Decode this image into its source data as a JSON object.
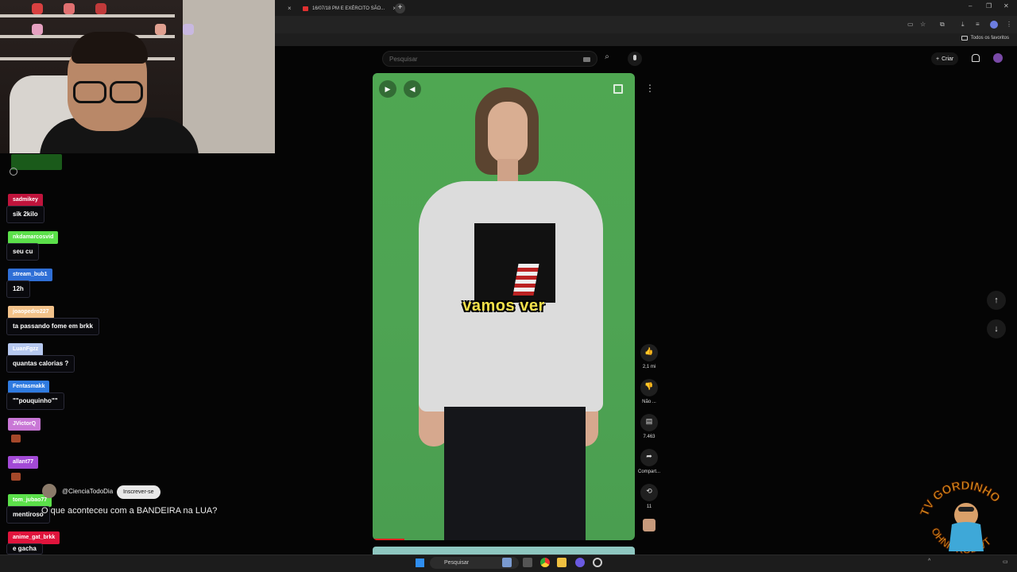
{
  "browser": {
    "tabs": [
      {
        "title": ""
      },
      {
        "title": "16/07/18 PM E EXÉRCITO SÃO..."
      }
    ],
    "bookmarks_label": "Todos os favoritos"
  },
  "youtube": {
    "search_placeholder": "Pesquisar",
    "create_label": "Criar",
    "caption": "vamos ver",
    "actions": {
      "likes": "2,1 mi",
      "dislike_label": "Não ...",
      "comments": "7.463",
      "share_label": "Compart...",
      "remix_count": "11"
    },
    "channel_name": "@CienciaTodoDia",
    "subscribe_label": "Inscrever-se",
    "short_title": "O que aconteceu com a BANDEIRA na LUA?"
  },
  "chat": {
    "messages": [
      {
        "user": "sadmikey",
        "text": "sik 2kilo",
        "color": "#c0143c"
      },
      {
        "user": "nkdamarcosvid",
        "text": "seu cu",
        "color": "#5be04a"
      },
      {
        "user": "stream_bub1",
        "text": "12h",
        "color": "#2f6fd6"
      },
      {
        "user": "joaopedro227",
        "text": "ta passando fome em brkk",
        "color": "#f2c28a"
      },
      {
        "user": "LuanFgzz",
        "text": "quantas calorias ?",
        "color": "#b6c8ef"
      },
      {
        "user": "Fentasmakk",
        "text": "\"\"pouquinho\"\"",
        "color": "#2f7be0"
      },
      {
        "user": "JVictorQ",
        "text": "",
        "color": "#c977d6"
      },
      {
        "user": "allant77",
        "text": "",
        "color": "#a34ad6"
      },
      {
        "user": "tom_jubao77",
        "text": "mentiroso",
        "color": "#5be04a"
      },
      {
        "user": "anime_gat_brkk",
        "text": "e gacha",
        "color": "#e0143c"
      }
    ]
  },
  "logo": {
    "top_text": "TV GORDINHO",
    "side_text": "OHNIGROD VT"
  },
  "taskbar": {
    "search_label": "Pesquisar"
  }
}
